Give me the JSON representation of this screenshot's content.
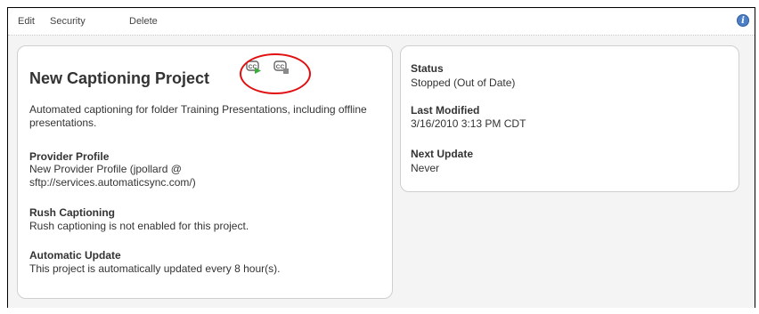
{
  "toolbar": {
    "edit": "Edit",
    "security": "Security",
    "delete": "Delete",
    "info_icon": "info-icon"
  },
  "project": {
    "title": "New Captioning Project",
    "start_caption_icon": "cc-play-icon",
    "stop_caption_icon": "cc-stop-icon",
    "description": "Automated captioning for folder Training Presentations, including offline presentations.",
    "provider_profile_label": "Provider Profile",
    "provider_profile_line1": "New Provider Profile (jpollard @",
    "provider_profile_line2": "sftp://services.automaticsync.com/)",
    "rush_label": "Rush Captioning",
    "rush_value": "Rush captioning is not enabled for this project.",
    "auto_update_label": "Automatic Update",
    "auto_update_value": "This project is automatically updated every 8 hour(s)."
  },
  "status_panel": {
    "status_label": "Status",
    "status_value": "Stopped (Out of Date)",
    "modified_label": "Last Modified",
    "modified_value": "3/16/2010 3:13 PM CDT",
    "next_label": "Next Update",
    "next_value": "Never"
  },
  "colors": {
    "highlight": "#e01010",
    "play_accent": "#3caa3c",
    "icon_gray": "#666666"
  }
}
